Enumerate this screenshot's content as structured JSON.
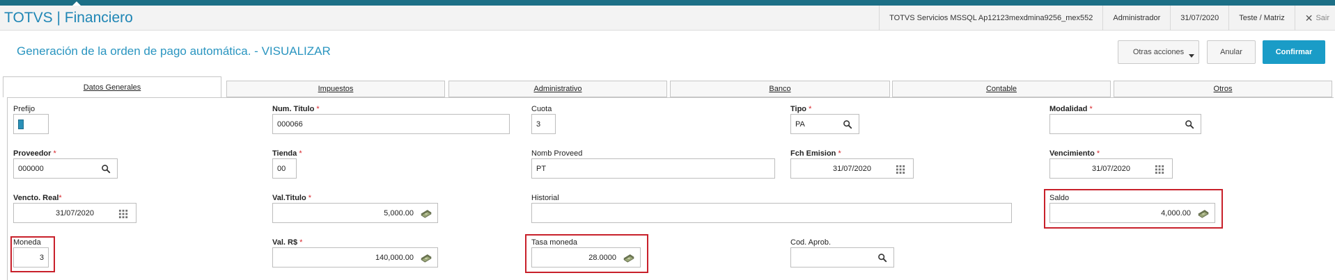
{
  "header": {
    "app_title": "TOTVS | Financiero",
    "server": "TOTVS Servicios MSSQL Ap12123mexdmina9256_mex552",
    "user": "Administrador",
    "date": "31/07/2020",
    "branch": "Teste / Matriz",
    "exit_label": "Sair"
  },
  "page": {
    "title": "Generación de la orden de pago automática. - VISUALIZAR",
    "actions": {
      "more": "Otras acciones",
      "cancel": "Anular",
      "confirm": "Confirmar"
    }
  },
  "tabs": [
    "Datos Generales",
    "Impuestos",
    "Administrativo",
    "Banco",
    "Contable",
    "Otros"
  ],
  "form": {
    "prefijo": {
      "label": "Prefijo",
      "value": ""
    },
    "num_titulo": {
      "label": "Num. Titulo",
      "value": "000066"
    },
    "cuota": {
      "label": "Cuota",
      "value": "3"
    },
    "tipo": {
      "label": "Tipo",
      "value": "PA"
    },
    "modalidad": {
      "label": "Modalidad",
      "value": ""
    },
    "proveedor": {
      "label": "Proveedor",
      "value": "000000"
    },
    "tienda": {
      "label": "Tienda",
      "value": "00"
    },
    "nomb_proveed": {
      "label": "Nomb Proveed",
      "value": "PT"
    },
    "fch_emision": {
      "label": "Fch Emision",
      "value": "31/07/2020"
    },
    "vencimiento": {
      "label": "Vencimiento",
      "value": "31/07/2020"
    },
    "vencto_real": {
      "label": "Vencto. Real",
      "value": "31/07/2020"
    },
    "val_titulo": {
      "label": "Val.Titulo",
      "value": "5,000.00"
    },
    "historial": {
      "label": "Historial",
      "value": ""
    },
    "saldo": {
      "label": "Saldo",
      "value": "4,000.00"
    },
    "moneda": {
      "label": "Moneda",
      "value": "3"
    },
    "val_rs": {
      "label": "Val. R$",
      "value": "140,000.00"
    },
    "tasa_moneda": {
      "label": "Tasa moneda",
      "value": "28.0000"
    },
    "cod_aprob": {
      "label": "Cod. Aprob.",
      "value": ""
    },
    "required_mark": "*"
  },
  "colors": {
    "accent": "#1a9cc7",
    "title": "#2a95c0",
    "highlight": "#c8202a",
    "required": "#d8262b"
  },
  "icons": {
    "lookup": "search-icon",
    "calendar": "calendar-icon",
    "money": "money-icon",
    "dropdown": "chevron-down-icon",
    "close": "close-icon"
  }
}
